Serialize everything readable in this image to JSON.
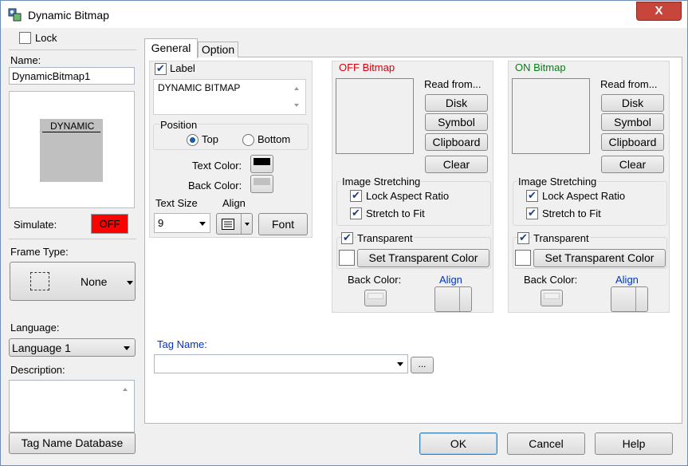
{
  "window": {
    "title": "Dynamic Bitmap",
    "close_label": "X"
  },
  "left": {
    "lock_label": "Lock",
    "name_label": "Name:",
    "name_value": "DynamicBitmap1",
    "preview_text": "DYNAMIC",
    "simulate_label": "Simulate:",
    "simulate_value": "OFF",
    "frame_type_label": "Frame Type:",
    "frame_type_value": "None",
    "language_label": "Language:",
    "language_value": "Language 1",
    "description_label": "Description:",
    "tag_db_button": "Tag Name Database"
  },
  "tabs": [
    {
      "label": "General"
    },
    {
      "label": "Option"
    }
  ],
  "general": {
    "label_checkbox": "Label",
    "label_text": "DYNAMIC BITMAP",
    "position_label": "Position",
    "top_label": "Top",
    "bottom_label": "Bottom",
    "text_color_label": "Text Color:",
    "back_color_label": "Back Color:",
    "text_size_label": "Text Size",
    "text_size_value": "9",
    "align_label": "Align",
    "font_button": "Font"
  },
  "off_bitmap": {
    "title": "OFF Bitmap",
    "read_from": "Read from...",
    "disk": "Disk",
    "symbol": "Symbol",
    "clipboard": "Clipboard",
    "clear": "Clear",
    "image_stretching": "Image Stretching",
    "lock_aspect": "Lock Aspect Ratio",
    "stretch_fit": "Stretch to Fit",
    "transparent": "Transparent",
    "set_transparent": "Set Transparent Color",
    "back_color": "Back Color:",
    "align": "Align"
  },
  "on_bitmap": {
    "title": "ON Bitmap",
    "read_from": "Read from...",
    "disk": "Disk",
    "symbol": "Symbol",
    "clipboard": "Clipboard",
    "clear": "Clear",
    "image_stretching": "Image Stretching",
    "lock_aspect": "Lock Aspect Ratio",
    "stretch_fit": "Stretch to Fit",
    "transparent": "Transparent",
    "set_transparent": "Set Transparent Color",
    "back_color": "Back Color:",
    "align": "Align"
  },
  "tag": {
    "label": "Tag Name:",
    "browse": "..."
  },
  "footer": {
    "ok": "OK",
    "cancel": "Cancel",
    "help": "Help"
  },
  "colors": {
    "off_title": "#d4000d",
    "on_title": "#0a7d16",
    "link_blue": "#0033cc",
    "simulate_bg": "#ff0000"
  }
}
